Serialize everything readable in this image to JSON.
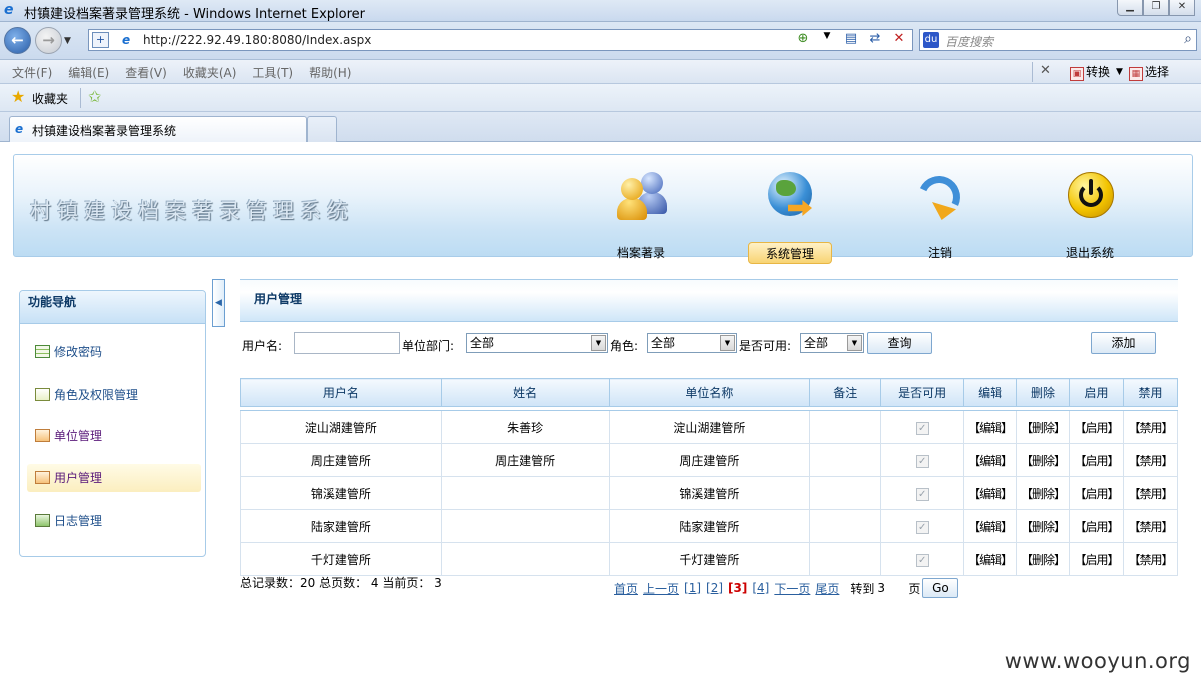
{
  "window": {
    "title": "村镇建设档案著录管理系统 - Windows Internet Explorer"
  },
  "address_bar": {
    "url": "http://222.92.49.180:8080/Index.aspx",
    "search_placeholder": "百度搜索"
  },
  "menu": {
    "items": [
      "文件(F)",
      "编辑(E)",
      "查看(V)",
      "收藏夹(A)",
      "工具(T)",
      "帮助(H)"
    ],
    "convert": "转换",
    "select": "选择"
  },
  "favorites": {
    "label": "收藏夹"
  },
  "tab": {
    "label": "村镇建设档案著录管理系统"
  },
  "banner": {
    "title": "村镇建设档案著录管理系统",
    "nav": [
      {
        "label": "档案著录",
        "icon": "users-icon"
      },
      {
        "label": "系统管理",
        "icon": "globe-icon",
        "active": true
      },
      {
        "label": "注销",
        "icon": "logout-arrow-icon"
      },
      {
        "label": "退出系统",
        "icon": "power-icon"
      }
    ]
  },
  "sidebar": {
    "title": "功能导航",
    "items": [
      {
        "label": "修改密码",
        "icon": "password-icon"
      },
      {
        "label": "角色及权限管理",
        "icon": "role-icon"
      },
      {
        "label": "单位管理",
        "icon": "unit-icon"
      },
      {
        "label": "用户管理",
        "icon": "user-manage-icon",
        "active": true
      },
      {
        "label": "日志管理",
        "icon": "log-icon"
      }
    ]
  },
  "panel": {
    "title": "用户管理"
  },
  "filter": {
    "username_label": "用户名:",
    "username_value": "",
    "dept_label": "单位部门:",
    "dept_value": "全部",
    "role_label": "角色:",
    "role_value": "全部",
    "enabled_label": "是否可用:",
    "enabled_value": "全部",
    "query_button": "查询",
    "add_button": "添加"
  },
  "table": {
    "columns": [
      "用户名",
      "姓名",
      "单位名称",
      "备注",
      "是否可用",
      "编辑",
      "删除",
      "启用",
      "禁用"
    ],
    "actions": {
      "edit": "【编辑】",
      "delete": "【删除】",
      "enable": "【启用】",
      "disable": "【禁用】"
    },
    "rows": [
      {
        "username": "淀山湖建管所",
        "name": "朱善珍",
        "unit": "淀山湖建管所",
        "note": "",
        "enabled": true
      },
      {
        "username": "周庄建管所",
        "name": "周庄建管所",
        "unit": "周庄建管所",
        "note": "",
        "enabled": true
      },
      {
        "username": "锦溪建管所",
        "name": "",
        "unit": "锦溪建管所",
        "note": "",
        "enabled": true
      },
      {
        "username": "陆家建管所",
        "name": "",
        "unit": "陆家建管所",
        "note": "",
        "enabled": true
      },
      {
        "username": "千灯建管所",
        "name": "",
        "unit": "千灯建管所",
        "note": "",
        "enabled": true
      }
    ]
  },
  "pager": {
    "summary": "总记录数：20 总页数： 4 当前页： 3",
    "first": "首页",
    "prev": "上一页",
    "pages": [
      "[1]",
      "[2]",
      "[3]",
      "[4]"
    ],
    "current_page_index": 2,
    "next": "下一页",
    "last": "尾页",
    "goto_label": "转到",
    "goto_value": "3",
    "page_unit": "页",
    "go_button": "Go"
  },
  "watermark": "www.wooyun.org"
}
